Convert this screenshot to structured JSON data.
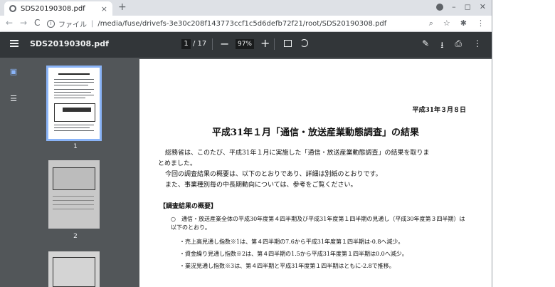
{
  "browser": {
    "tab_title": "SDS20190308.pdf",
    "tab_close": "×",
    "new_tab": "+",
    "win_min": "–",
    "win_max": "◻",
    "win_close": "✕",
    "back": "←",
    "forward": "→",
    "reload": "C",
    "info_icon": "i",
    "site_label": "ファイル",
    "url": "/media/fuse/drivefs-3e30c208f143773ccf1c5d6defb72f21/root/SDS20190308.pdf",
    "search_icon": "⌕",
    "star_icon": "☆",
    "ext_icon": "✱",
    "menu_icon": "⋮"
  },
  "viewer": {
    "filename": "SDS20190308.pdf",
    "page_current": "1",
    "page_total": "/ 17",
    "zoom_minus": "−",
    "zoom_level": "97%",
    "zoom_plus": "+",
    "pen_icon": "✎",
    "download_icon": "⭳",
    "print_icon": "⎙",
    "more_icon": "⋮",
    "side_thumb_icon": "▣",
    "side_outline_icon": "☰"
  },
  "thumbnails": [
    {
      "num": "1",
      "selected": true
    },
    {
      "num": "2",
      "selected": false
    }
  ],
  "document": {
    "date": "平成31年３月８日",
    "title": "平成31年１月「通信・放送産業動態調査」の結果",
    "intro_line1": "総務省は、このたび、平成31年１月に実施した「通信・放送産業動態調査」の結果を取りま",
    "intro_line2": "とめました。",
    "intro_line3": "今回の調査結果の概要は、以下のとおりであり、詳細は別紙のとおりです。",
    "intro_line4": "また、事業種別毎の中長期動向については、参考をご覧ください。",
    "summary_heading": "【調査結果の概要】",
    "bullet_main": "○　通信・放送産業全体の平成30年度第４四半期及び平成31年度第１四半期の見通し（平成30年度第３四半期）は以下のとおり。",
    "sub1": "・売上高見通し指数※1は、第４四半期の7.6から平成31年度第１四半期は-0.8へ減少。",
    "sub2": "・資金繰り見通し指数※2は、第４四半期の1.5から平成31年度第１四半期は0.0へ減少。",
    "sub3": "・業況見通し指数※3は、第４四半期と平成31年度第１四半期はともに-2.8で推移。"
  },
  "colors": {
    "viewer_bar": "#323639",
    "viewer_bg": "#525659",
    "accent": "#8ab4f8"
  }
}
